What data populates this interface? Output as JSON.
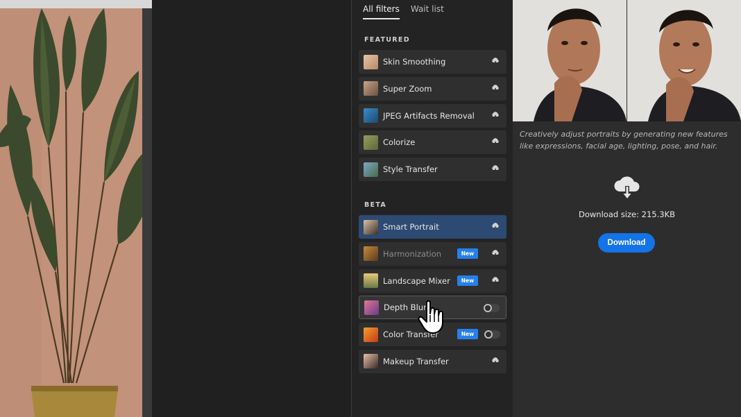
{
  "tabs": [
    {
      "label": "All filters",
      "active": true
    },
    {
      "label": "Wait list",
      "active": false
    }
  ],
  "sections": {
    "featured": "FEATURED",
    "beta": "BETA"
  },
  "featured_filters": [
    {
      "name": "Skin Smoothing",
      "control": "download"
    },
    {
      "name": "Super Zoom",
      "control": "download"
    },
    {
      "name": "JPEG Artifacts Removal",
      "control": "download"
    },
    {
      "name": "Colorize",
      "control": "download"
    },
    {
      "name": "Style Transfer",
      "control": "download"
    }
  ],
  "beta_filters": [
    {
      "name": "Smart Portrait",
      "control": "download",
      "state": "selected"
    },
    {
      "name": "Harmonization",
      "control": "download",
      "badge": "New",
      "state": "disabled"
    },
    {
      "name": "Landscape Mixer",
      "control": "download",
      "badge": "New"
    },
    {
      "name": "Depth Blur",
      "control": "toggle",
      "state": "hovered"
    },
    {
      "name": "Color Transfer",
      "control": "toggle",
      "badge": "New"
    },
    {
      "name": "Makeup Transfer",
      "control": "download"
    }
  ],
  "detail": {
    "description": "Creatively adjust portraits by generating new features like expressions, facial age, lighting, pose, and hair.",
    "download_size": "Download size: 215.3KB",
    "download_button": "Download"
  },
  "colors": {
    "accent": "#1473e6",
    "selected_row": "#2c4a72",
    "badge": "#2680eb",
    "panel_bg": "#232323"
  },
  "icons": {
    "download": "cloud-download-icon",
    "cursor": "hand-pointer-icon"
  }
}
